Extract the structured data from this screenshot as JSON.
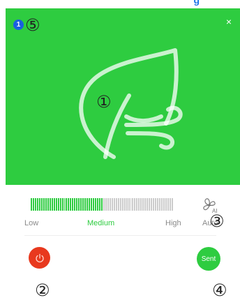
{
  "header": {
    "cut_text": "g"
  },
  "hero": {
    "close_glyph": "×",
    "background": "#2ecc40"
  },
  "badge": {
    "count": "1"
  },
  "markers": {
    "m1": "①",
    "m2": "②",
    "m3": "③",
    "m4": "④",
    "m5": "⑤"
  },
  "fan_speed": {
    "labels": {
      "low": "Low",
      "medium": "Medium",
      "high": "High",
      "auto": "Auto"
    },
    "selected": "Medium",
    "level_fraction": 0.5,
    "total_ticks": 69,
    "active_ticks": 35,
    "active_color": "#2ecc40",
    "inactive_color": "#cccccc"
  },
  "fan_icon": {
    "name": "fan-auto-icon",
    "text": "AI"
  },
  "buttons": {
    "power": {
      "icon": "power-icon",
      "color": "#e8391e"
    },
    "send": {
      "label": "Sent",
      "color": "#2ecc40"
    }
  }
}
